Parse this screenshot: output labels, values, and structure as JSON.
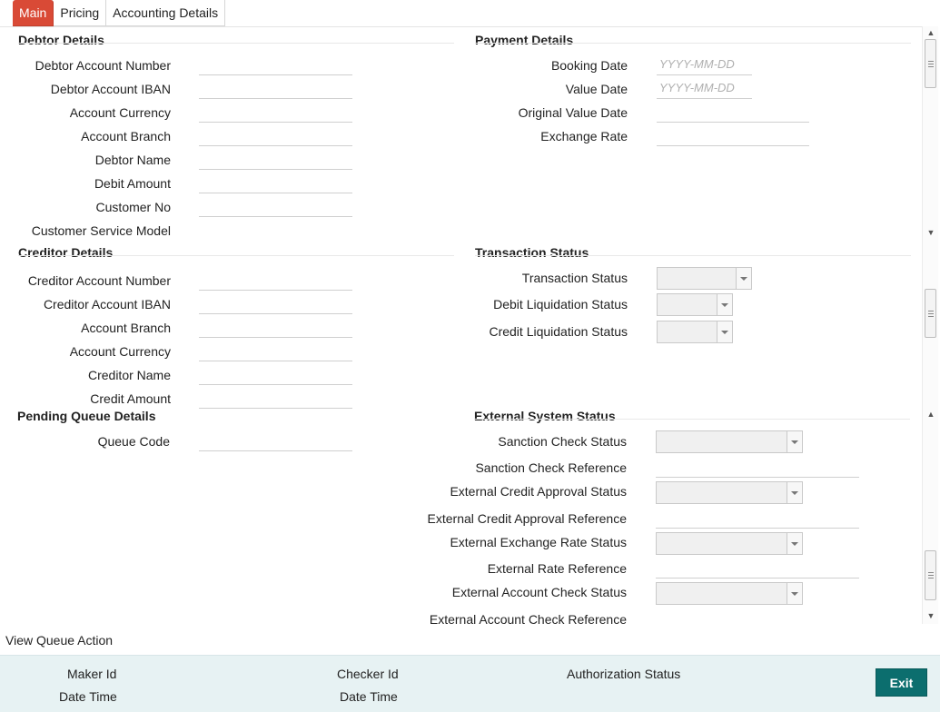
{
  "tabs": [
    "Main",
    "Pricing",
    "Accounting Details"
  ],
  "debtor": {
    "title": "Debtor Details",
    "fields": [
      "Debtor Account Number",
      "Debtor Account IBAN",
      "Account Currency",
      "Account Branch",
      "Debtor Name",
      "Debit Amount",
      "Customer No",
      "Customer Service Model"
    ]
  },
  "payment": {
    "title": "Payment Details",
    "fields": [
      "Booking Date",
      "Value Date",
      "Original Value Date",
      "Exchange Rate"
    ],
    "date_placeholder": "YYYY-MM-DD"
  },
  "creditor": {
    "title": "Creditor Details",
    "fields": [
      "Creditor Account Number",
      "Creditor Account IBAN",
      "Account Branch",
      "Account Currency",
      "Creditor Name",
      "Credit Amount"
    ]
  },
  "txn_status": {
    "title": "Transaction Status",
    "fields": [
      "Transaction Status",
      "Debit Liquidation Status",
      "Credit Liquidation Status"
    ]
  },
  "pending": {
    "title": "Pending Queue Details",
    "fields": [
      "Queue Code"
    ]
  },
  "external": {
    "title": "External System Status",
    "fields": [
      "Sanction Check Status",
      "Sanction Check Reference",
      "External Credit Approval Status",
      "External Credit Approval Reference",
      "External Exchange Rate Status",
      "External Rate Reference",
      "External Account Check Status",
      "External Account Check Reference"
    ]
  },
  "queue_action": "View Queue Action",
  "footer": {
    "maker_id": "Maker Id",
    "date_time_1": "Date Time",
    "checker_id": "Checker Id",
    "date_time_2": "Date Time",
    "auth_status": "Authorization Status",
    "exit": "Exit"
  },
  "colors": {
    "active_tab": "#d94a36",
    "exit_button": "#0c6e6e",
    "footer_bg": "#e7f2f3"
  }
}
